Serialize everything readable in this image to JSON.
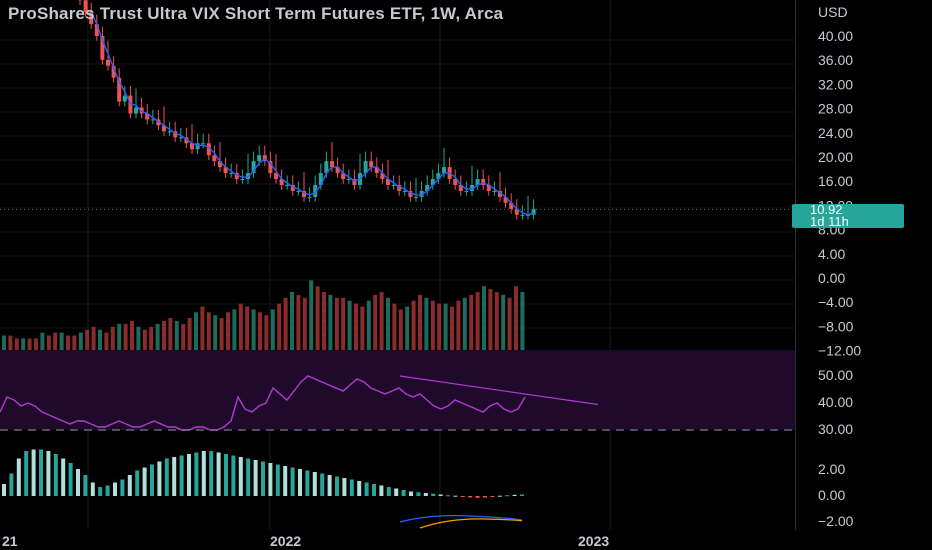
{
  "header": {
    "title": "ProShares Trust Ultra VIX Short Term Futures ETF, 1W, Arca",
    "currency": "USD"
  },
  "price_tag": {
    "last": "10.92",
    "countdown": "1d 11h"
  },
  "colors": {
    "up": "#26a69a",
    "down": "#ef5350",
    "wick_up": "#3fbfa9",
    "ma_line": "#2962ff",
    "rsi_line": "#b13ccc",
    "rsi_band": "#1f0a2c",
    "hist_pos_light": "#b2dfdb",
    "hist_pos_dark": "#26a69a",
    "hist_neg": "#ef5350"
  },
  "chart_data": [
    {
      "type": "candlestick",
      "title": "ProShares Trust Ultra VIX Short Term Futures ETF, 1W, Arca",
      "price_axis_ticks": [
        "40.00",
        "36.00",
        "32.00",
        "28.00",
        "24.00",
        "20.00",
        "16.00",
        "12.00",
        "8.00",
        "4.00",
        "0.00",
        "−4.00",
        "−8.00",
        "−12.00"
      ],
      "time_axis_ticks": [
        "21",
        "2022",
        "2023"
      ],
      "ylim": [
        -12,
        44
      ],
      "last_price": 10.92,
      "close_series": [
        46,
        44,
        42,
        40,
        36,
        35,
        33,
        29,
        30,
        27,
        28,
        27,
        26,
        26,
        25,
        24,
        24,
        23,
        23,
        22,
        21,
        22,
        22,
        20,
        19,
        18,
        17,
        17,
        16,
        16,
        17,
        19,
        20,
        19,
        17,
        16,
        15,
        15,
        14,
        14,
        13,
        13,
        15,
        17,
        19,
        18,
        17,
        16,
        16,
        15,
        17,
        19,
        18,
        17,
        16,
        15,
        15,
        14,
        14,
        13,
        13,
        14,
        15,
        16,
        17,
        18,
        16,
        15,
        14,
        14,
        15,
        16,
        15,
        14,
        14,
        13,
        12,
        11,
        10,
        10,
        10,
        11
      ],
      "series_note": "weekly candles, red = down week, green = up week"
    },
    {
      "type": "bar",
      "name": "volume",
      "values": [
        5,
        5,
        4,
        4,
        4,
        4,
        6,
        5,
        6,
        6,
        5,
        5,
        6,
        7,
        8,
        7,
        6,
        8,
        9,
        9,
        10,
        8,
        7,
        8,
        9,
        10,
        11,
        10,
        9,
        11,
        13,
        15,
        13,
        12,
        11,
        13,
        14,
        16,
        15,
        14,
        13,
        12,
        14,
        16,
        18,
        20,
        19,
        18,
        24,
        22,
        20,
        19,
        18,
        18,
        17,
        16,
        15,
        17,
        19,
        20,
        18,
        16,
        14,
        15,
        17,
        19,
        18,
        17,
        16,
        16,
        15,
        17,
        18,
        19,
        20,
        22,
        21,
        20,
        19,
        18,
        22,
        20
      ]
    },
    {
      "type": "line",
      "name": "RSI",
      "axis_ticks": [
        "50.00",
        "40.00",
        "30.00"
      ],
      "ylim": [
        30,
        55
      ],
      "values": [
        36,
        41,
        40,
        38,
        39,
        38,
        36,
        35,
        34,
        33,
        32,
        33,
        33,
        32,
        31,
        31,
        32,
        33,
        32,
        31,
        31,
        32,
        33,
        32,
        31,
        31,
        30,
        30,
        31,
        31,
        30,
        30,
        31,
        33,
        41,
        37,
        36,
        38,
        39,
        44,
        42,
        40,
        43,
        46,
        48,
        47,
        46,
        45,
        44,
        43,
        45,
        47,
        46,
        44,
        43,
        42,
        43,
        44,
        42,
        41,
        42,
        40,
        38,
        37,
        38,
        40,
        39,
        38,
        37,
        36,
        38,
        39,
        37,
        36,
        37,
        41
      ]
    },
    {
      "type": "bar",
      "name": "oscillator histogram",
      "axis_ticks": [
        "2.00",
        "0.00",
        "−2.00"
      ],
      "ylim": [
        -2.5,
        3.5
      ],
      "values": [
        0.8,
        1.5,
        2.5,
        3.0,
        3.1,
        3.1,
        3.0,
        2.8,
        2.5,
        2.2,
        1.8,
        1.4,
        0.9,
        0.6,
        0.7,
        0.9,
        1.1,
        1.4,
        1.7,
        1.9,
        2.1,
        2.3,
        2.5,
        2.6,
        2.7,
        2.8,
        2.9,
        3.0,
        3.0,
        2.9,
        2.8,
        2.7,
        2.6,
        2.5,
        2.4,
        2.3,
        2.2,
        2.1,
        2.0,
        1.9,
        1.8,
        1.7,
        1.6,
        1.5,
        1.4,
        1.3,
        1.2,
        1.1,
        1.0,
        0.9,
        0.8,
        0.7,
        0.6,
        0.5,
        0.4,
        0.3,
        0.25,
        0.2,
        0.15,
        0.1,
        0.05,
        0.02,
        -0.05,
        -0.1,
        -0.12,
        -0.1,
        -0.05,
        0.02,
        0.05,
        0.08,
        0.1
      ]
    }
  ]
}
